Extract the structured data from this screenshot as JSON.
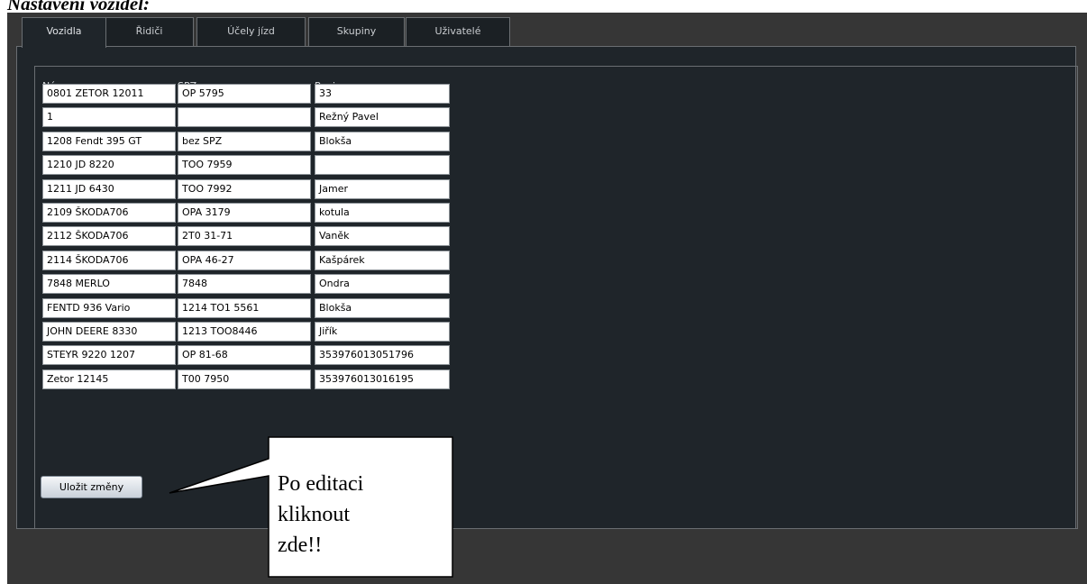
{
  "doc_caption": "Nastavení vozidel:",
  "tabs": [
    {
      "label": "Vozidla",
      "active": true
    },
    {
      "label": "Řidiči",
      "active": false
    },
    {
      "label": "Účely jízd",
      "active": false
    },
    {
      "label": "Skupiny",
      "active": false
    },
    {
      "label": "Uživatelé",
      "active": false
    }
  ],
  "grid": {
    "columns": [
      "Název",
      "SPZ",
      "Popis"
    ],
    "rows": [
      [
        "0801 ZETOR  12011",
        "OP 5795",
        "33"
      ],
      [
        "1",
        "",
        "Režný Pavel"
      ],
      [
        "1208 Fendt 395 GT",
        "bez SPZ",
        "Blokša"
      ],
      [
        "1210 JD 8220",
        "TOO 7959",
        ""
      ],
      [
        "1211 JD 6430",
        "TOO 7992",
        "Jamer"
      ],
      [
        "2109 ŠKODA706",
        "OPA 3179",
        "kotula"
      ],
      [
        "2112 ŠKODA706",
        "2T0 31-71",
        "Vaněk"
      ],
      [
        "2114 ŠKODA706",
        "OPA 46-27",
        "Kašpárek"
      ],
      [
        "7848 MERLO",
        "7848",
        "Ondra"
      ],
      [
        "FENTD 936 Vario",
        "1214 TO1 5561",
        "Blokša"
      ],
      [
        "JOHN DEERE 8330",
        "1213 TOO8446",
        "Jiřík"
      ],
      [
        "STEYR 9220 1207",
        "OP 81-68",
        "353976013051796"
      ],
      [
        "Zetor 12145",
        "T00 7950",
        "353976013016195"
      ]
    ]
  },
  "save_button": {
    "label": "Uložit změny"
  },
  "callout": {
    "lines": [
      "Po editaci",
      "kliknout",
      "zde!!"
    ]
  }
}
